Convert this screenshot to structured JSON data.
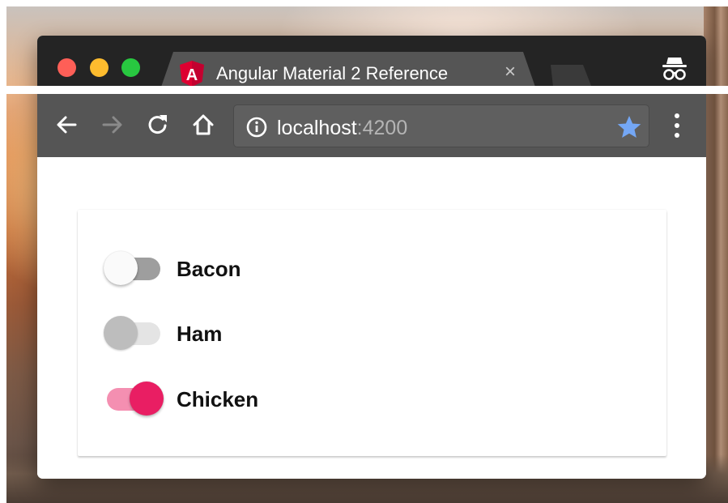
{
  "browser": {
    "tab": {
      "title": "Angular Material 2 Reference",
      "close_glyph": "×",
      "favicon": "angular-logo",
      "favicon_letter": "A"
    },
    "toolbar": {
      "url_host": "localhost",
      "url_port": ":4200",
      "icons": [
        "back-arrow-icon",
        "forward-arrow-icon",
        "reload-icon",
        "home-icon",
        "info-icon",
        "star-icon",
        "menu-icon"
      ]
    },
    "incognito_icon": "incognito-icon"
  },
  "toggles": [
    {
      "label": "Bacon",
      "state": "off"
    },
    {
      "label": "Ham",
      "state": "disabled"
    },
    {
      "label": "Chicken",
      "state": "on"
    }
  ],
  "colors": {
    "accent": "#e91e63",
    "accent_track": "#f48fb1",
    "star": "#74a7f5",
    "toolbar": "#555555",
    "tabstrip": "#242424"
  }
}
